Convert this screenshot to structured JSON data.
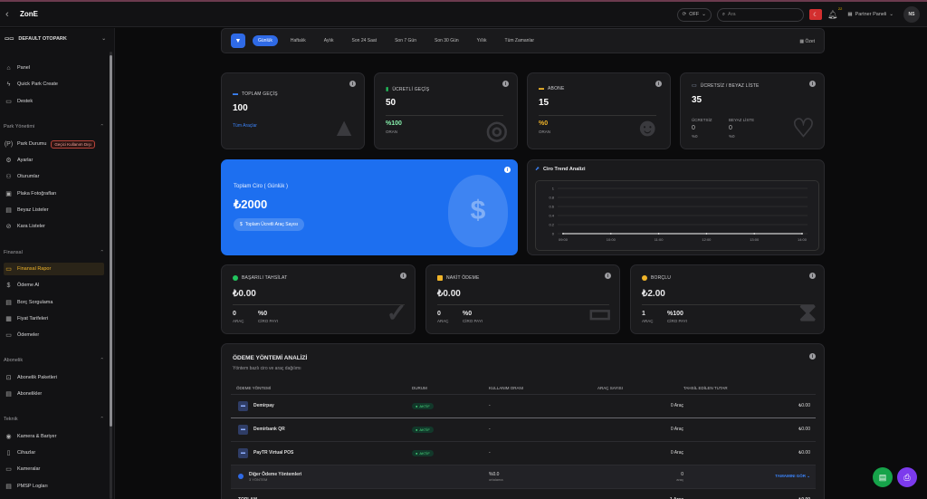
{
  "app": {
    "title": "ZonE"
  },
  "topbar": {
    "back_icon": "chevron-left-icon",
    "status": "OFF",
    "search_placeholder": "Ara",
    "notif_count": "22",
    "panel_label": "Partner Paneli",
    "avatar": "NS"
  },
  "sidebar": {
    "org": "DEFAULT OTOPARK",
    "top": [
      {
        "label": "Panel",
        "icon": "home-icon"
      },
      {
        "label": "Quick Park Create",
        "icon": "lightning-icon"
      },
      {
        "label": "Destek",
        "icon": "support-icon"
      }
    ],
    "sec_park": "Park Yönetimi",
    "park_items": [
      {
        "label": "Park Durumu",
        "icon": "parking-icon",
        "tag": "Geçici Kullanım Dışı"
      },
      {
        "label": "Ayarlar",
        "icon": "gear-icon"
      },
      {
        "label": "Oturumlar",
        "icon": "users-icon"
      },
      {
        "label": "Plaka Fotoğrafları",
        "icon": "photo-icon"
      },
      {
        "label": "Beyaz Listeler",
        "icon": "list-icon"
      },
      {
        "label": "Kara Listeler",
        "icon": "block-icon"
      }
    ],
    "sec_fin": "Finansal",
    "fin_items": [
      {
        "label": "Finansal Rapor",
        "icon": "report-icon"
      },
      {
        "label": "Ödeme Al",
        "icon": "payment-icon"
      },
      {
        "label": "Borç Sorgulama",
        "icon": "debt-icon"
      },
      {
        "label": "Fiyat Tarifeleri",
        "icon": "tariff-icon"
      },
      {
        "label": "Ödemeler",
        "icon": "payments-icon"
      }
    ],
    "sec_abone": "Abonelik",
    "abone_items": [
      {
        "label": "Abonelik Paketleri",
        "icon": "package-icon"
      },
      {
        "label": "Abonelikler",
        "icon": "subscription-icon"
      }
    ],
    "sec_teknik": "Teknik",
    "teknik_items": [
      {
        "label": "Kamera & Bariyer",
        "icon": "camera-icon"
      },
      {
        "label": "Cihazlar",
        "icon": "device-icon"
      },
      {
        "label": "Kameralar",
        "icon": "camera2-icon"
      },
      {
        "label": "PMSP Logları",
        "icon": "log-icon"
      }
    ]
  },
  "filters": {
    "tabs": [
      "Günlük",
      "Haftalık",
      "Aylık",
      "Son 24 Saat",
      "Son 7 Gün",
      "Son 30 Gün",
      "Yıllık",
      "Tüm Zamanlar"
    ],
    "summary": "Özet"
  },
  "stats": {
    "toplam": {
      "label": "TOPLAM GEÇİŞ",
      "value": "100",
      "link": "Tüm Araçlar"
    },
    "ucretli": {
      "label": "ÜCRETLİ GEÇİŞ",
      "value": "50",
      "pct": "%100",
      "pct_label": "ORAN"
    },
    "abone": {
      "label": "ABONE",
      "value": "15",
      "pct": "%0",
      "pct_label": "ORAN"
    },
    "beyaz": {
      "label": "ÜCRETSİZ / BEYAZ LİSTE",
      "value": "35",
      "c1_label": "ÜCRETSİZ",
      "c1_val": "0",
      "c1_pct": "%0",
      "c2_label": "BEYAZ LİSTE",
      "c2_val": "0",
      "c2_pct": "%0"
    }
  },
  "ciro": {
    "title": "Toplam Ciro ( Günlük )",
    "value": "₺2000",
    "button": "Toplam Ücretli Araç Sayısı"
  },
  "trend": {
    "title": "Ciro Trend Analizi"
  },
  "chart_data": {
    "type": "line",
    "title": "Ciro Trend Analizi",
    "x": [
      "09:00",
      "10:00",
      "11:00",
      "12:00",
      "13:00",
      "14:00"
    ],
    "series": [
      {
        "values": [
          0,
          0,
          0,
          0,
          0,
          0
        ]
      }
    ],
    "yticks": [
      "1",
      "0.8",
      "0.6",
      "0.4",
      "0.2",
      "0"
    ],
    "ylim": [
      0,
      1
    ],
    "grid": true
  },
  "tahsilat": [
    {
      "label": "BAŞARILI TAHSİLAT",
      "value": "₺0.00",
      "count": "0",
      "count_label": "ARAÇ",
      "pct": "%0",
      "pct_label": "CİRO PAYI",
      "dot": "#22c55e",
      "icon": "check-icon"
    },
    {
      "label": "NAKİT ÖDEME",
      "value": "₺0.00",
      "count": "0",
      "count_label": "ARAÇ",
      "pct": "%0",
      "pct_label": "CİRO PAYI",
      "dot": "#f0b429",
      "icon": "wallet-icon"
    },
    {
      "label": "BORÇLU",
      "value": "₺2.00",
      "count": "1",
      "count_label": "ARAÇ",
      "pct": "%100",
      "pct_label": "CİRO PAYI",
      "dot": "#f0b429",
      "icon": "hourglass-icon"
    }
  ],
  "payments": {
    "title": "ÖDEME YÖNTEMİ ANALİZİ",
    "subtitle": "Yöntem bazlı ciro ve araç dağılımı",
    "headers": [
      "ÖDEME YÖNTEMİ",
      "DURUM",
      "KULLANIM ORANI",
      "ARAÇ SAYISI",
      "TAHSİL EDİLEN TUTAR"
    ],
    "rows": [
      {
        "name": "Demirpay",
        "status": "AKTİF",
        "rate": "-",
        "count": "0 Araç",
        "amount": "₺0.00"
      },
      {
        "name": "Demirbank QR",
        "status": "AKTİF",
        "rate": "-",
        "count": "0 Araç",
        "amount": "₺0.00"
      },
      {
        "name": "PayTR Virtual POS",
        "status": "AKTİF",
        "rate": "-",
        "count": "0 Araç",
        "amount": "₺0.00"
      }
    ],
    "other": {
      "name": "Diğer Ödeme Yöntemleri",
      "sub": "3 YÖNTEM",
      "rate": "%0.0",
      "rate_sub": "ortalama",
      "count": "0",
      "count_sub": "araç",
      "action": "TAMAMINI GÖR"
    },
    "total": {
      "label": "TOPLAM",
      "count": "1 Araç",
      "amount": "₺0.00"
    }
  },
  "colors": {
    "accent": "#1d6ff0",
    "active": "#f0b429",
    "success": "#22c55e",
    "fab1": "#16a34a",
    "fab2": "#7c3aed"
  }
}
